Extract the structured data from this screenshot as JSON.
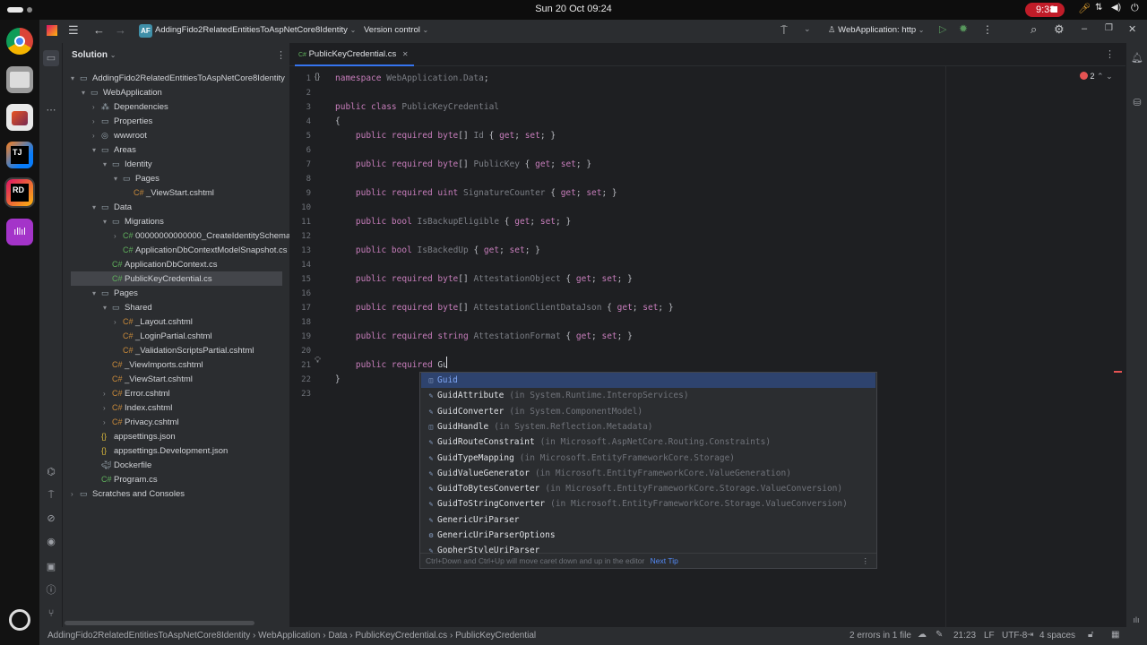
{
  "topbar": {
    "clock": "Sun 20 Oct  09:24",
    "recording_time": "9:38"
  },
  "header": {
    "project_badge": "AF",
    "project_name": "AddingFido2RelatedEntitiesToAspNetCore8Identity",
    "version_control": "Version control",
    "run_config": "WebApplication: http"
  },
  "project": {
    "title": "Solution",
    "rows": [
      {
        "label": "AddingFido2RelatedEntitiesToAspNetCore8Identity",
        "depth": 0,
        "arrow": "▾",
        "kind": "sln"
      },
      {
        "label": "WebApplication",
        "depth": 1,
        "arrow": "▾",
        "kind": "proj"
      },
      {
        "label": "Dependencies",
        "depth": 2,
        "arrow": "›",
        "kind": "dep"
      },
      {
        "label": "Properties",
        "depth": 2,
        "arrow": "›",
        "kind": "folder"
      },
      {
        "label": "wwwroot",
        "depth": 2,
        "arrow": "›",
        "kind": "web"
      },
      {
        "label": "Areas",
        "depth": 2,
        "arrow": "▾",
        "kind": "folder"
      },
      {
        "label": "Identity",
        "depth": 3,
        "arrow": "▾",
        "kind": "folder"
      },
      {
        "label": "Pages",
        "depth": 4,
        "arrow": "▾",
        "kind": "folder"
      },
      {
        "label": "_ViewStart.cshtml",
        "depth": 5,
        "arrow": "",
        "kind": "cshtml"
      },
      {
        "label": "Data",
        "depth": 2,
        "arrow": "▾",
        "kind": "folder"
      },
      {
        "label": "Migrations",
        "depth": 3,
        "arrow": "▾",
        "kind": "folder"
      },
      {
        "label": "00000000000000_CreateIdentitySchema",
        "depth": 4,
        "arrow": "›",
        "kind": "cs"
      },
      {
        "label": "ApplicationDbContextModelSnapshot.cs",
        "depth": 4,
        "arrow": "",
        "kind": "cs"
      },
      {
        "label": "ApplicationDbContext.cs",
        "depth": 3,
        "arrow": "",
        "kind": "cs"
      },
      {
        "label": "PublicKeyCredential.cs",
        "depth": 3,
        "arrow": "",
        "kind": "cs",
        "selected": true
      },
      {
        "label": "Pages",
        "depth": 2,
        "arrow": "▾",
        "kind": "folder"
      },
      {
        "label": "Shared",
        "depth": 3,
        "arrow": "▾",
        "kind": "folder"
      },
      {
        "label": "_Layout.cshtml",
        "depth": 4,
        "arrow": "›",
        "kind": "cshtml"
      },
      {
        "label": "_LoginPartial.cshtml",
        "depth": 4,
        "arrow": "",
        "kind": "cshtml"
      },
      {
        "label": "_ValidationScriptsPartial.cshtml",
        "depth": 4,
        "arrow": "",
        "kind": "cshtml"
      },
      {
        "label": "_ViewImports.cshtml",
        "depth": 3,
        "arrow": "",
        "kind": "cshtml"
      },
      {
        "label": "_ViewStart.cshtml",
        "depth": 3,
        "arrow": "",
        "kind": "cshtml"
      },
      {
        "label": "Error.cshtml",
        "depth": 3,
        "arrow": "›",
        "kind": "cshtml"
      },
      {
        "label": "Index.cshtml",
        "depth": 3,
        "arrow": "›",
        "kind": "cshtml"
      },
      {
        "label": "Privacy.cshtml",
        "depth": 3,
        "arrow": "›",
        "kind": "cshtml"
      },
      {
        "label": "appsettings.json",
        "depth": 2,
        "arrow": "",
        "kind": "json"
      },
      {
        "label": "appsettings.Development.json",
        "depth": 2,
        "arrow": "",
        "kind": "json"
      },
      {
        "label": "Dockerfile",
        "depth": 2,
        "arrow": "",
        "kind": "docker"
      },
      {
        "label": "Program.cs",
        "depth": 2,
        "arrow": "",
        "kind": "cs"
      },
      {
        "label": "Scratches and Consoles",
        "depth": 0,
        "arrow": "›",
        "kind": "scratch"
      }
    ]
  },
  "editor": {
    "tab_label": "PublicKeyCredential.cs",
    "error_count": "2",
    "lines": [
      [
        [
          "namespace ",
          "ns"
        ],
        [
          "WebApplication.Data",
          "nm"
        ],
        [
          ";",
          "pl"
        ]
      ],
      [],
      [
        [
          "public class ",
          "kw"
        ],
        [
          "PublicKeyCredential",
          "nm"
        ]
      ],
      [
        [
          "{",
          "pl"
        ]
      ],
      [
        [
          "    public required ",
          "kw"
        ],
        [
          "byte",
          "kw"
        ],
        [
          "[] ",
          "pl"
        ],
        [
          "Id",
          "nm"
        ],
        [
          " { ",
          "pl"
        ],
        [
          "get",
          "kw"
        ],
        [
          "; ",
          "pl"
        ],
        [
          "set",
          "kw"
        ],
        [
          "; }",
          "pl"
        ]
      ],
      [],
      [
        [
          "    public required ",
          "kw"
        ],
        [
          "byte",
          "kw"
        ],
        [
          "[] ",
          "pl"
        ],
        [
          "PublicKey",
          "nm"
        ],
        [
          " { ",
          "pl"
        ],
        [
          "get",
          "kw"
        ],
        [
          "; ",
          "pl"
        ],
        [
          "set",
          "kw"
        ],
        [
          "; }",
          "pl"
        ]
      ],
      [],
      [
        [
          "    public required ",
          "kw"
        ],
        [
          "uint ",
          "kw"
        ],
        [
          "SignatureCounter",
          "nm"
        ],
        [
          " { ",
          "pl"
        ],
        [
          "get",
          "kw"
        ],
        [
          "; ",
          "pl"
        ],
        [
          "set",
          "kw"
        ],
        [
          "; }",
          "pl"
        ]
      ],
      [],
      [
        [
          "    public ",
          "kw"
        ],
        [
          "bool ",
          "kw"
        ],
        [
          "IsBackupEligible",
          "nm"
        ],
        [
          " { ",
          "pl"
        ],
        [
          "get",
          "kw"
        ],
        [
          "; ",
          "pl"
        ],
        [
          "set",
          "kw"
        ],
        [
          "; }",
          "pl"
        ]
      ],
      [],
      [
        [
          "    public ",
          "kw"
        ],
        [
          "bool ",
          "kw"
        ],
        [
          "IsBackedUp",
          "nm"
        ],
        [
          " { ",
          "pl"
        ],
        [
          "get",
          "kw"
        ],
        [
          "; ",
          "pl"
        ],
        [
          "set",
          "kw"
        ],
        [
          "; }",
          "pl"
        ]
      ],
      [],
      [
        [
          "    public required ",
          "kw"
        ],
        [
          "byte",
          "kw"
        ],
        [
          "[] ",
          "pl"
        ],
        [
          "AttestationObject",
          "nm"
        ],
        [
          " { ",
          "pl"
        ],
        [
          "get",
          "kw"
        ],
        [
          "; ",
          "pl"
        ],
        [
          "set",
          "kw"
        ],
        [
          "; }",
          "pl"
        ]
      ],
      [],
      [
        [
          "    public required ",
          "kw"
        ],
        [
          "byte",
          "kw"
        ],
        [
          "[] ",
          "pl"
        ],
        [
          "AttestationClientDataJson",
          "nm"
        ],
        [
          " { ",
          "pl"
        ],
        [
          "get",
          "kw"
        ],
        [
          "; ",
          "pl"
        ],
        [
          "set",
          "kw"
        ],
        [
          "; }",
          "pl"
        ]
      ],
      [],
      [
        [
          "    public required ",
          "kw"
        ],
        [
          "string ",
          "kw"
        ],
        [
          "AttestationFormat",
          "nm"
        ],
        [
          " { ",
          "pl"
        ],
        [
          "get",
          "kw"
        ],
        [
          "; ",
          "pl"
        ],
        [
          "set",
          "kw"
        ],
        [
          "; }",
          "pl"
        ]
      ],
      [],
      [
        [
          "    public required ",
          "kw"
        ],
        [
          "Gu",
          "pl"
        ]
      ],
      [
        [
          "}",
          "pl"
        ]
      ],
      []
    ]
  },
  "completion": {
    "items": [
      {
        "name": "Guid",
        "hint": "",
        "icon": "◫"
      },
      {
        "name": "GuidAttribute",
        "hint": "(in System.Runtime.InteropServices)",
        "icon": "✎"
      },
      {
        "name": "GuidConverter",
        "hint": "(in System.ComponentModel)",
        "icon": "✎"
      },
      {
        "name": "GuidHandle",
        "hint": "(in System.Reflection.Metadata)",
        "icon": "◫"
      },
      {
        "name": "GuidRouteConstraint",
        "hint": "(in Microsoft.AspNetCore.Routing.Constraints)",
        "icon": "✎"
      },
      {
        "name": "GuidTypeMapping",
        "hint": "(in Microsoft.EntityFrameworkCore.Storage)",
        "icon": "✎"
      },
      {
        "name": "GuidValueGenerator",
        "hint": "(in Microsoft.EntityFrameworkCore.ValueGeneration)",
        "icon": "✎"
      },
      {
        "name": "GuidToBytesConverter",
        "hint": "(in Microsoft.EntityFrameworkCore.Storage.ValueConversion)",
        "icon": "✎"
      },
      {
        "name": "GuidToStringConverter",
        "hint": "(in Microsoft.EntityFrameworkCore.Storage.ValueConversion)",
        "icon": "✎"
      },
      {
        "name": "GenericUriParser",
        "hint": "",
        "icon": "✎"
      },
      {
        "name": "GenericUriParserOptions",
        "hint": "",
        "icon": "⚙"
      },
      {
        "name": "GopherStyleUriParser",
        "hint": "",
        "icon": "✎"
      }
    ],
    "footer_tip": "Ctrl+Down and Ctrl+Up will move caret down and up in the editor",
    "next_tip": "Next Tip"
  },
  "status": {
    "breadcrumbs": [
      "AddingFido2RelatedEntitiesToAspNetCore8Identity",
      "WebApplication",
      "Data",
      "PublicKeyCredential.cs",
      "PublicKeyCredential"
    ],
    "errors": "2 errors in 1 file",
    "position": "21:23",
    "line_ending": "LF",
    "encoding": "UTF-8",
    "indent": "4 spaces"
  },
  "colors": {
    "accent": "#3574f0",
    "selection": "#2e436e",
    "error": "#e55353"
  }
}
